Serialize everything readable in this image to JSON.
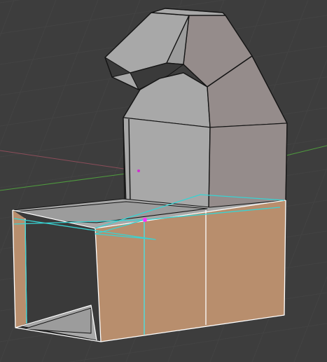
{
  "viewport": {
    "background": "#3d3d3d",
    "grid_color": "#434343",
    "axis_x_color": "#8c4d5a",
    "axis_y_color": "#4f9b3e",
    "mesh_colors": {
      "face_light": "#a8a8a8",
      "face_mid": "#9c9c9c",
      "face_shade": "#958c8b",
      "face_dark": "#3a3a3a",
      "face_selected": "#b88e6d",
      "edge": "#141414",
      "edge_selected": "#ffffff",
      "knife_edge": "#38d3d3",
      "vertex_active": "#ff30ff",
      "object_origin": "#d030d0"
    }
  }
}
